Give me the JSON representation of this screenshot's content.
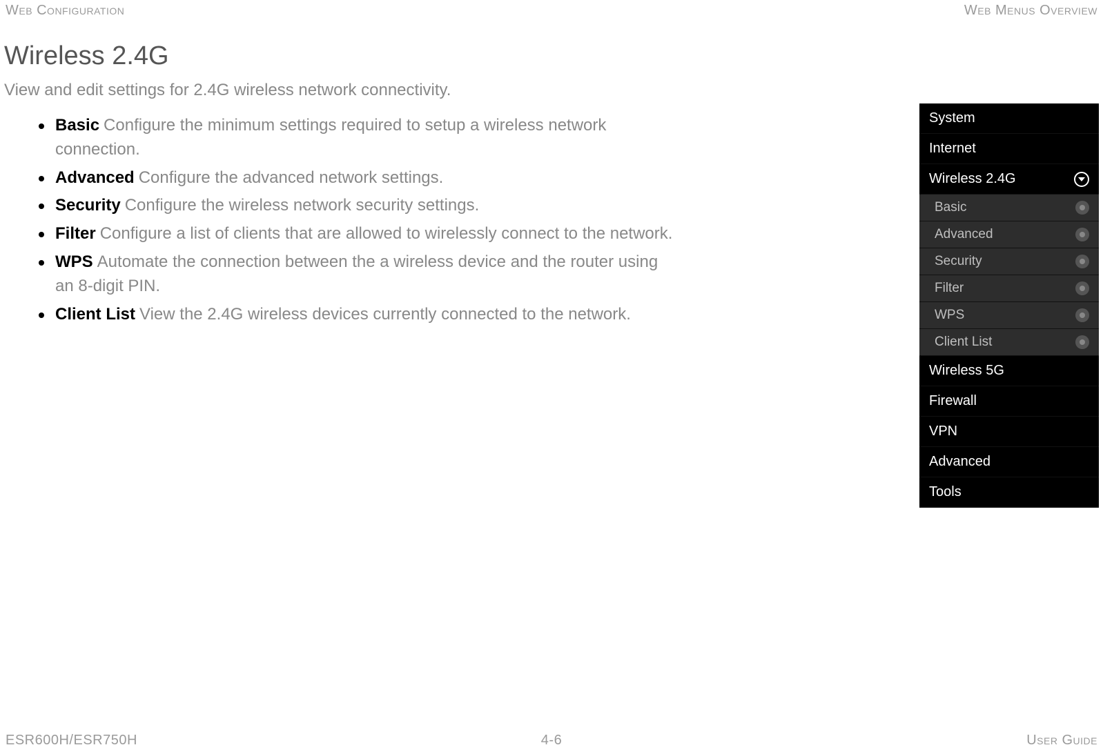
{
  "header": {
    "left": "Web Configuration",
    "right": "Web Menus Overview"
  },
  "footer": {
    "left": "ESR600H/ESR750H",
    "center": "4-6",
    "right": "User Guide"
  },
  "section": {
    "title": "Wireless 2.4G",
    "subtitle": "View and edit settings for 2.4G wireless network connectivity.",
    "items": [
      {
        "term": "Basic",
        "desc": "Configure the minimum settings required to setup a wireless network connection."
      },
      {
        "term": "Advanced",
        "desc": "Configure the advanced network settings."
      },
      {
        "term": "Security",
        "desc": "Configure the wireless network security settings."
      },
      {
        "term": "Filter",
        "desc": "Configure a list of clients that are allowed to wirelessly connect to the network."
      },
      {
        "term": "WPS",
        "desc": "Automate the connection between the a wireless device and the router using an 8-digit PIN."
      },
      {
        "term": "Client List",
        "desc": "View the 2.4G wireless devices currently connected to the network."
      }
    ]
  },
  "menu": {
    "top": [
      "System",
      "Internet"
    ],
    "expanded": "Wireless 2.4G",
    "sub": [
      "Basic",
      "Advanced",
      "Security",
      "Filter",
      "WPS",
      "Client List"
    ],
    "bottom": [
      "Wireless 5G",
      "Firewall",
      "VPN",
      "Advanced",
      "Tools"
    ]
  }
}
